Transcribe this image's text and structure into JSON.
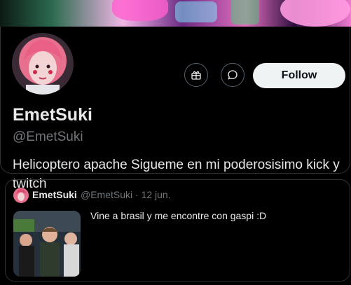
{
  "profile": {
    "display_name": "EmetSuki",
    "handle": "@EmetSuki",
    "bio": "Helicoptero apache Sigueme en mi poderosisimo kick y twitch",
    "follow_label": "Follow"
  },
  "icons": {
    "gift": "gift-icon",
    "message": "message-icon"
  },
  "quote": {
    "name": "EmetSuki",
    "handle_date": "@EmetSuki · 12 jun.",
    "text": "Vine a brasil y me encontre con gaspi :D"
  },
  "colors": {
    "background": "#000000",
    "text": "#e7e9ea",
    "muted": "#71767b",
    "border": "#2f3336",
    "follow_bg": "#eff3f4",
    "follow_text": "#0f1419"
  }
}
